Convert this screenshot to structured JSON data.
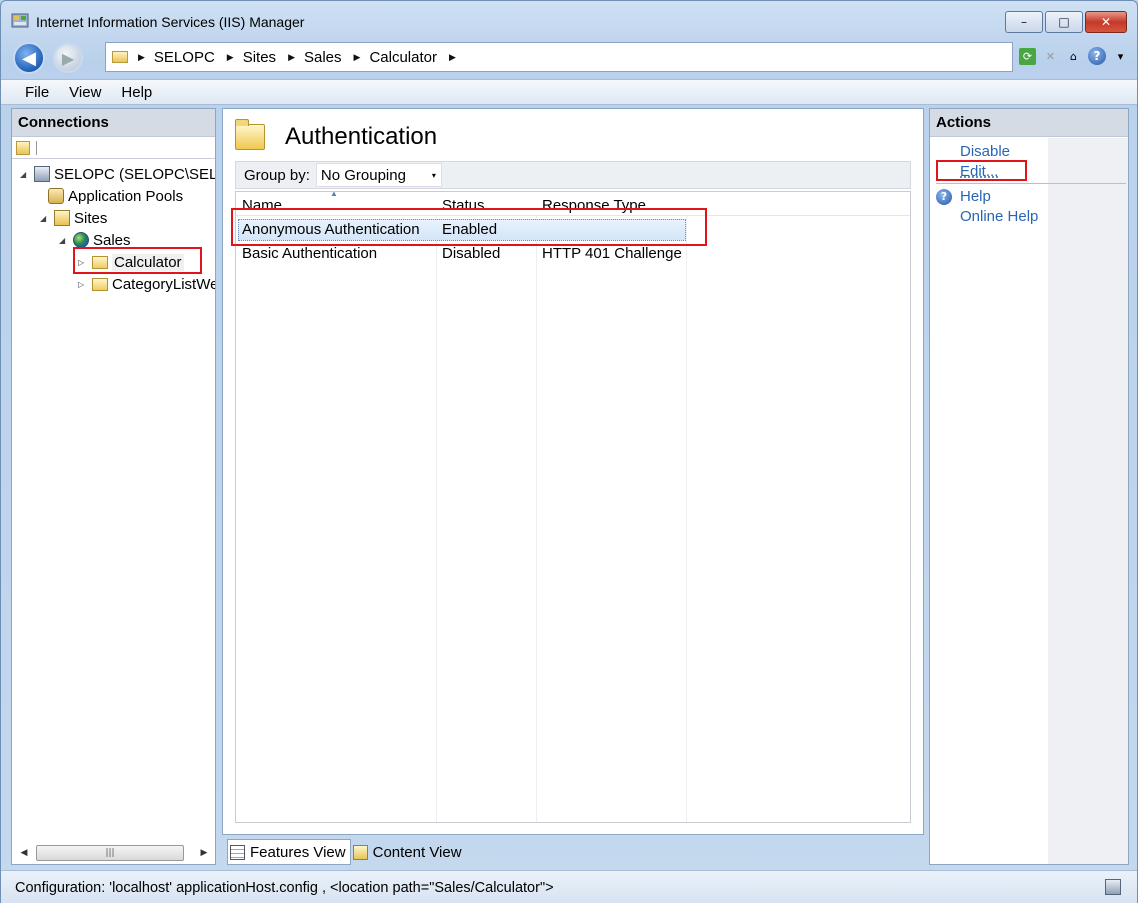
{
  "window": {
    "title": "Internet Information Services (IIS) Manager",
    "controls": {
      "minimize": "–",
      "maximize": "□",
      "close": "✕"
    }
  },
  "nav": {
    "back_icon": "◀",
    "forward_icon": "▶",
    "breadcrumb": [
      "SELOPC",
      "Sites",
      "Sales",
      "Calculator"
    ],
    "crumb_sep": "▶",
    "help_glyph": "?"
  },
  "menu": {
    "file": "File",
    "view": "View",
    "help": "Help"
  },
  "connections": {
    "header": "Connections",
    "tree": [
      {
        "label": "SELOPC (SELOPC\\SELO)",
        "twisty": "◢",
        "icon": "server-icon"
      },
      {
        "label": "Application Pools",
        "twisty": "",
        "icon": "app-pools-icon"
      },
      {
        "label": "Sites",
        "twisty": "◢",
        "icon": "sites-icon"
      },
      {
        "label": "Sales",
        "twisty": "◢",
        "icon": "globe-icon"
      },
      {
        "label": "Calculator",
        "twisty": "▷",
        "icon": "folder-icon"
      },
      {
        "label": "CategoryListWe",
        "twisty": "▷",
        "icon": "folder-icon"
      }
    ],
    "scroll": {
      "left": "◀",
      "right": "▶",
      "grip": "|||"
    }
  },
  "main": {
    "title": "Authentication",
    "group_by_label": "Group by:",
    "group_by_value": "No Grouping",
    "dropdown_glyph": "▾",
    "columns": [
      "Name",
      "Status",
      "Response Type"
    ],
    "sort_glyph": "▲",
    "rows": [
      {
        "name": "Anonymous Authentication",
        "status": "Enabled",
        "response": ""
      },
      {
        "name": "Basic Authentication",
        "status": "Disabled",
        "response": "HTTP 401 Challenge"
      }
    ]
  },
  "view_tabs": {
    "features": "Features View",
    "content": "Content View"
  },
  "actions": {
    "header": "Actions",
    "disable": "Disable",
    "edit": "Edit...",
    "help": "Help",
    "online_help": "Online Help",
    "help_glyph": "?"
  },
  "status": {
    "text": "Configuration: 'localhost' applicationHost.config , <location path=\"Sales/Calculator\">"
  },
  "colors": {
    "annotation": "#e0151b",
    "link": "#2866b5"
  }
}
